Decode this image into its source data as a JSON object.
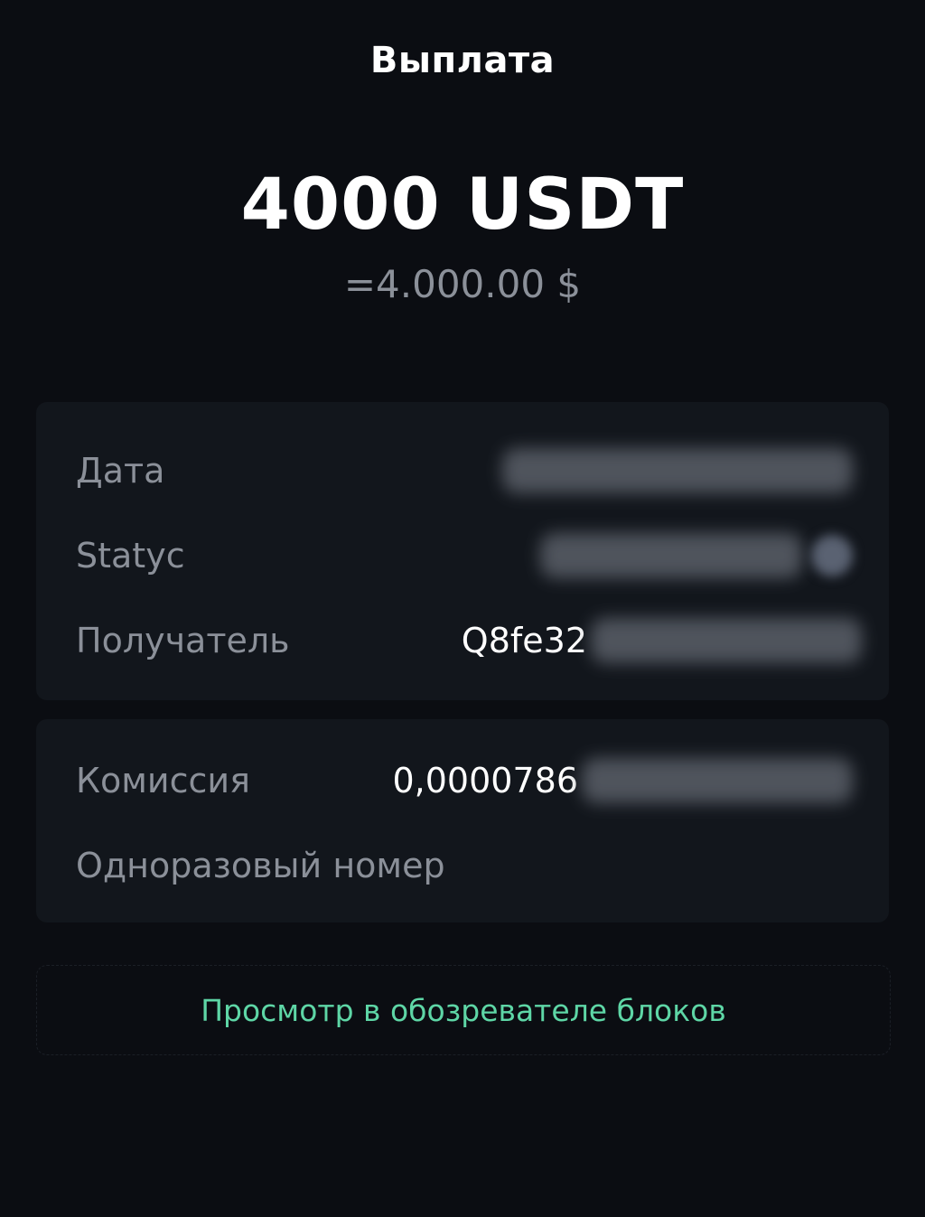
{
  "header": {
    "title": "Выплата"
  },
  "amount": {
    "crypto": "4000 USDT",
    "fiat": "=4.000.00 $"
  },
  "details": {
    "date_label": "Дата",
    "status_label": "Statyc",
    "recipient_label": "Получатель",
    "recipient_value_visible": "Q8fe32"
  },
  "fee": {
    "commission_label": "Комиссия",
    "commission_value_visible": "0,0000786",
    "nonce_label": "Одноразовый номер"
  },
  "explorer": {
    "link_label": "Просмотр в обозревателе блоков"
  },
  "colors": {
    "background": "#0b0d12",
    "card": "#12161c",
    "muted_text": "#8b9099",
    "accent_link": "#5ed6a6"
  },
  "icons": {
    "status_icon": "status-indicator-icon"
  }
}
